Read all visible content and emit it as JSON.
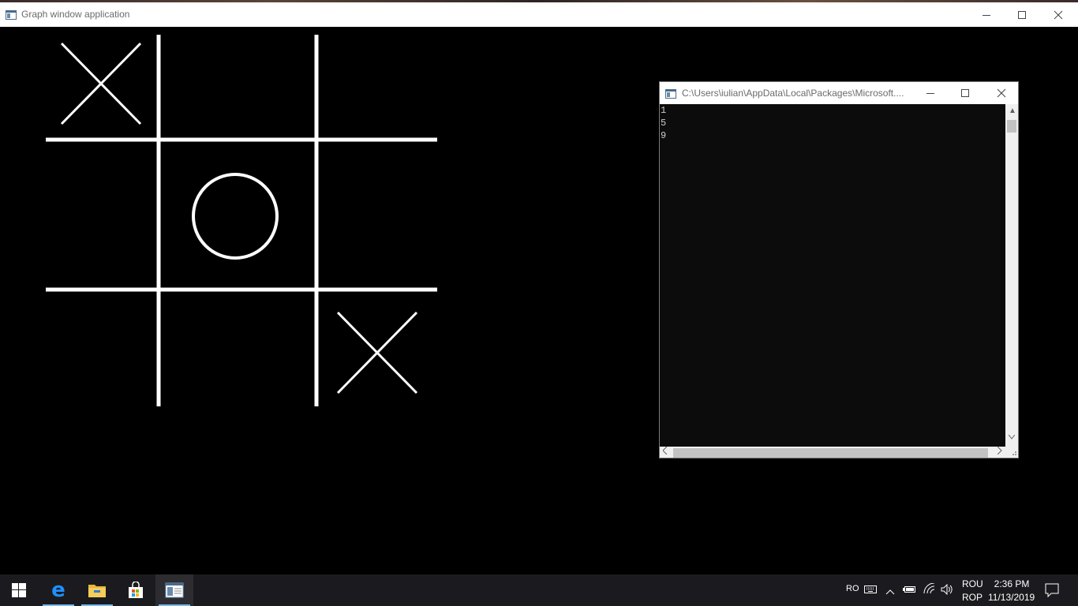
{
  "graph_window": {
    "title": "Graph window application",
    "icon": "app-window-icon",
    "board": {
      "cells": [
        "X",
        "",
        "",
        "",
        "O",
        "",
        "",
        "",
        "X"
      ]
    }
  },
  "console_window": {
    "title": "C:\\Users\\iulian\\AppData\\Local\\Packages\\Microsoft....",
    "icon": "console-window-icon",
    "lines": [
      "1",
      "5",
      "9"
    ]
  },
  "taskbar": {
    "items": [
      "start-icon",
      "edge-icon",
      "file-explorer-icon",
      "store-icon",
      "graph-app-icon"
    ],
    "tray": {
      "input_lang": "RO",
      "lang_top": "ROU",
      "lang_bottom": "ROP",
      "time": "2:36 PM",
      "date": "11/13/2019"
    }
  },
  "colors": {
    "board_lines": "#ffffff",
    "canvas_bg": "#000000",
    "console_bg": "#0c0c0c",
    "console_text": "#cccccc",
    "taskbar_bg": "#1b1b1f",
    "taskbar_accent": "#76b9ed"
  }
}
